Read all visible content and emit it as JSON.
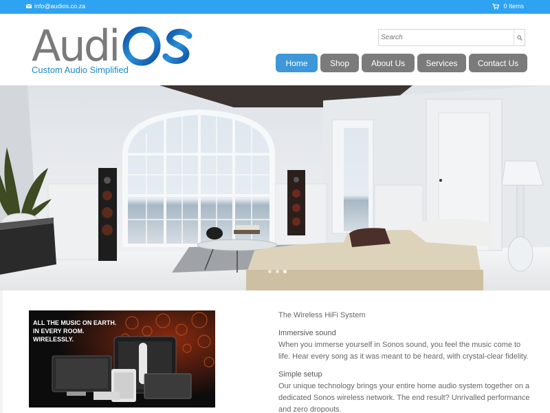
{
  "topbar": {
    "email": "info@audios.co.za",
    "cart_label": "0 Items",
    "icons": [
      "envelope-icon",
      "cart-icon"
    ],
    "color": "#2ea3f2"
  },
  "brand": {
    "name_part1": "Audi",
    "name_part2": "OS",
    "tagline": "Custom Audio Simplified",
    "accent": "#1e73be"
  },
  "search": {
    "placeholder": "Search",
    "value": ""
  },
  "nav": {
    "items": [
      {
        "label": "Home",
        "active": true
      },
      {
        "label": "Shop",
        "active": false
      },
      {
        "label": "About Us",
        "active": false
      },
      {
        "label": "Services",
        "active": false
      },
      {
        "label": "Contact Us",
        "active": false
      }
    ],
    "active_color": "#3d97d8",
    "inactive_color": "#7b7b7b"
  },
  "slider": {
    "slide_count": 3,
    "active_slide": 3
  },
  "promo": {
    "line1": "ALL THE MUSIC ON EARTH.",
    "line2": "IN EVERY ROOM.",
    "line3": "WIRELESSLY."
  },
  "content": {
    "title": "The Wireless HiFi System",
    "sections": [
      {
        "heading": "Immersive sound",
        "body": "When you immerse yourself in Sonos sound, you feel the music come to life. Hear every song as it was meant to be heard, with crystal-clear fidelity."
      },
      {
        "heading": "Simple setup",
        "body": "Our unique technology brings your entire home audio system together on a dedicated Sonos wireless network. The end result? Unrivalled performance and zero dropouts."
      }
    ]
  }
}
